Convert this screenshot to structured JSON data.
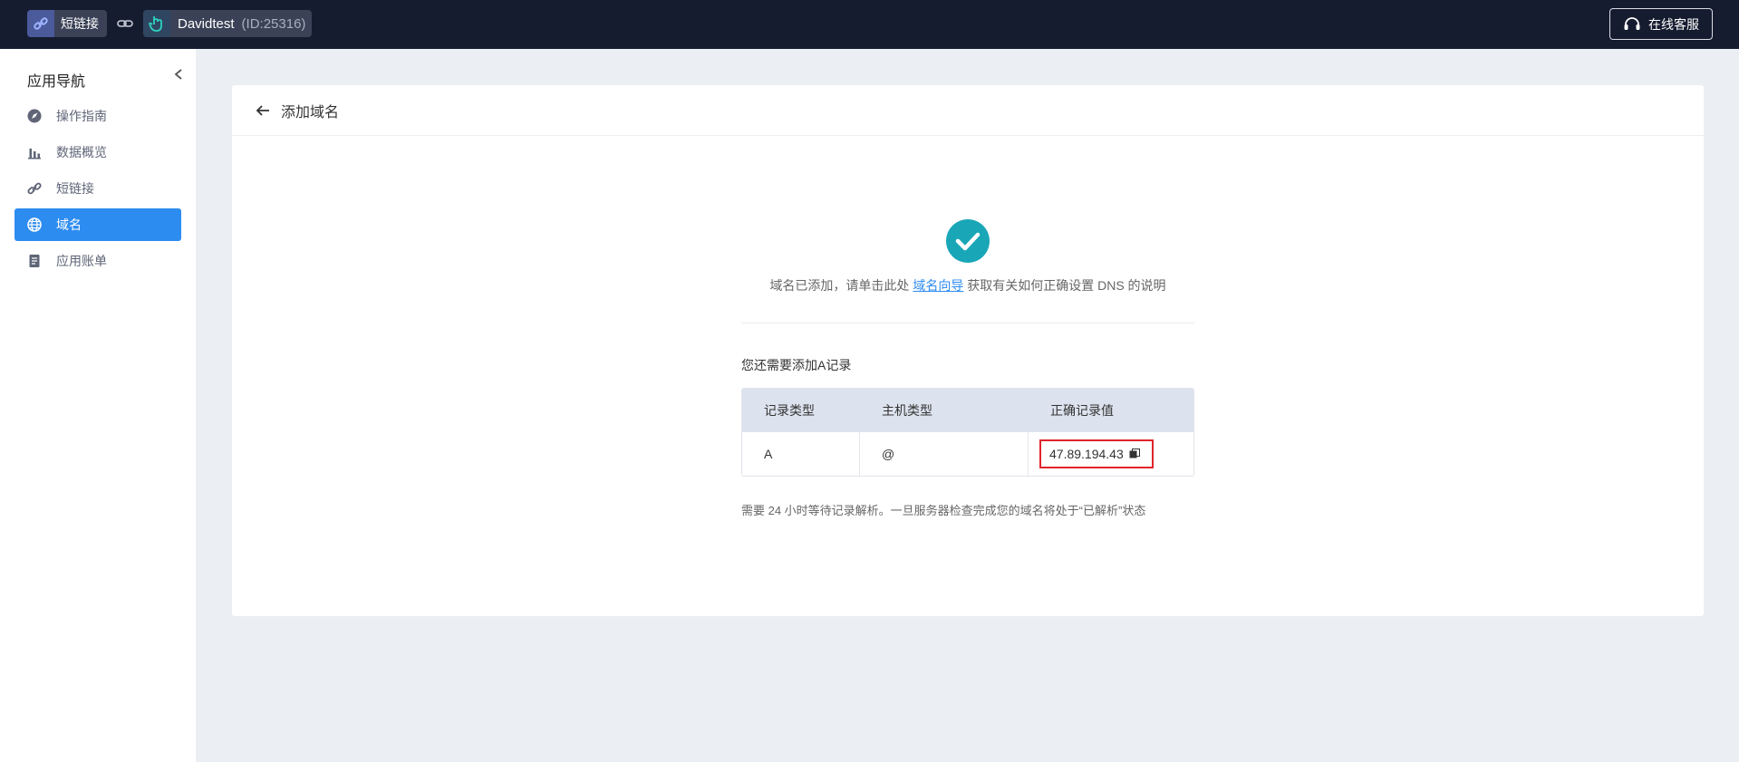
{
  "topbar": {
    "app_label": "短链接",
    "user_name": "Davidtest",
    "user_id": "(ID:25316)",
    "support_label": "在线客服"
  },
  "sidebar": {
    "title": "应用导航",
    "items": [
      {
        "label": "操作指南",
        "icon": "navigation-icon",
        "active": false
      },
      {
        "label": "数据概览",
        "icon": "bar-chart-icon",
        "active": false
      },
      {
        "label": "短链接",
        "icon": "link-icon",
        "active": false
      },
      {
        "label": "域名",
        "icon": "globe-icon",
        "active": true
      },
      {
        "label": "应用账单",
        "icon": "bill-icon",
        "active": false
      }
    ]
  },
  "main": {
    "title": "添加域名",
    "notice_prefix": "域名已添加，请单击此处",
    "notice_link": "域名向导",
    "notice_suffix": "获取有关如何正确设置 DNS 的说明",
    "need_record": "您还需要添加A记录",
    "table": {
      "headers": [
        "记录类型",
        "主机类型",
        "正确记录值"
      ],
      "row": {
        "type": "A",
        "host": "@",
        "value": "47.89.194.43"
      }
    },
    "wait_note": "需要 24 小时等待记录解析。一旦服务器检查完成您的域名将处于“已解析”状态"
  },
  "colors": {
    "topbar_bg": "#161c30",
    "accent": "#2d8cf0",
    "success": "#19a7b8",
    "highlight_border": "#e0242b"
  }
}
